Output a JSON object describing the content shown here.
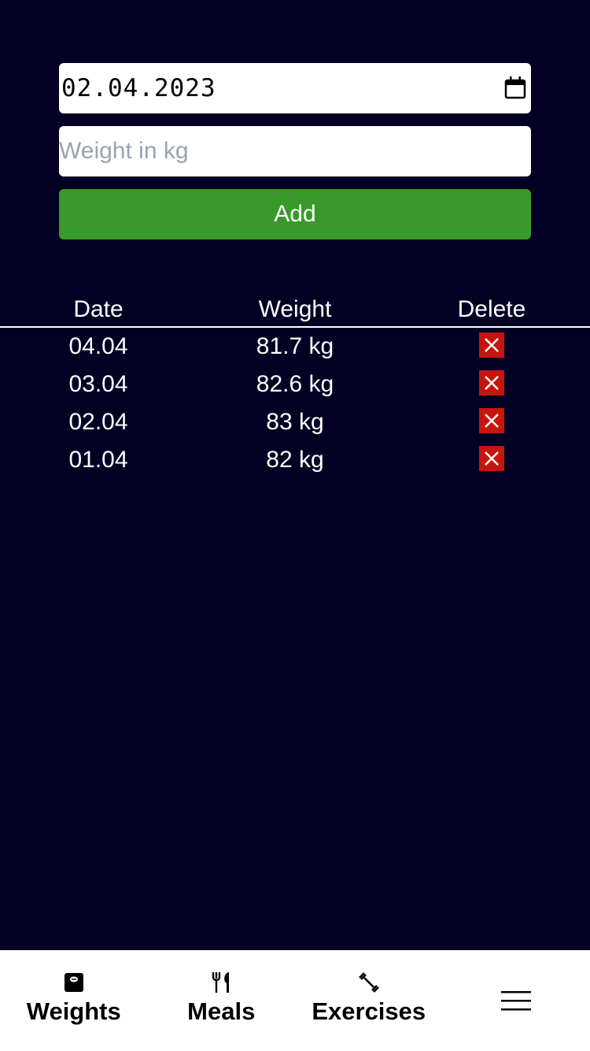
{
  "form": {
    "date_value": "02.04.2023",
    "weight_placeholder": "Weight in kg",
    "add_label": "Add"
  },
  "table": {
    "headers": {
      "date": "Date",
      "weight": "Weight",
      "delete": "Delete"
    },
    "rows": [
      {
        "date": "04.04",
        "weight": "81.7 kg"
      },
      {
        "date": "03.04",
        "weight": "82.6 kg"
      },
      {
        "date": "02.04",
        "weight": "83 kg"
      },
      {
        "date": "01.04",
        "weight": "82 kg"
      }
    ]
  },
  "nav": {
    "items": [
      {
        "label": "Weights",
        "icon": "scale-icon"
      },
      {
        "label": "Meals",
        "icon": "fork-knife-icon"
      },
      {
        "label": "Exercises",
        "icon": "dumbbell-icon"
      },
      {
        "label": "",
        "icon": "hamburger-menu-icon"
      }
    ]
  },
  "colors": {
    "background": "#030024",
    "add_button": "#389a29",
    "delete_button": "#c7150d",
    "navbar": "#ffffff"
  }
}
